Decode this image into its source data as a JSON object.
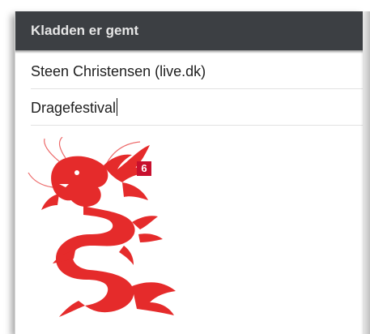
{
  "header": {
    "title": "Kladden er gemt"
  },
  "compose": {
    "to_value": "Steen Christensen (live.dk)",
    "subject_value": "Dragefestival"
  },
  "attachment": {
    "icon": "dragon-image",
    "badge": "6"
  },
  "colors": {
    "header_bg": "#3c3f43",
    "dragon": "#e52b2b",
    "badge": "#c8102e"
  }
}
